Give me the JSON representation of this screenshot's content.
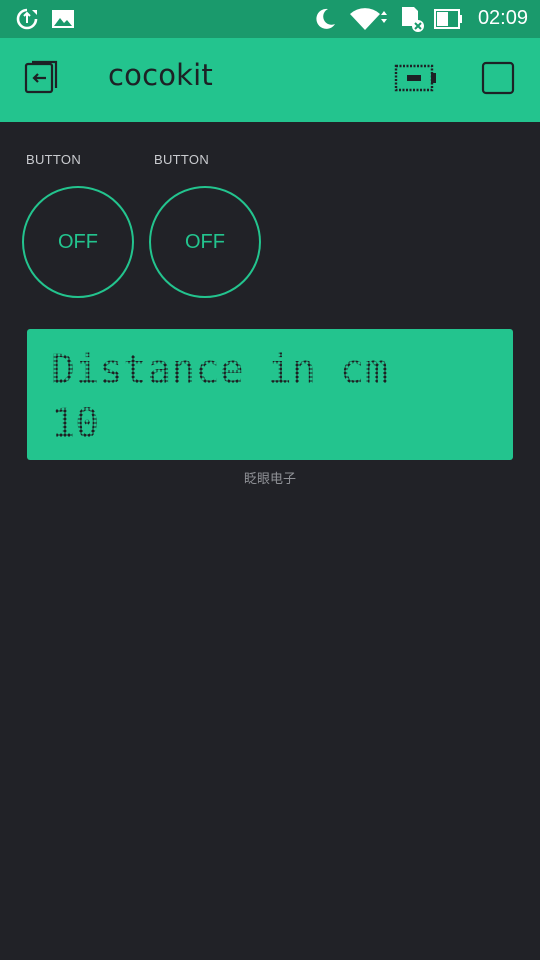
{
  "status_bar": {
    "time": "02:09",
    "icons": [
      "sync-icon",
      "image-icon",
      "moon-icon",
      "wifi-icon",
      "sd-card-icon",
      "battery-icon"
    ]
  },
  "toolbar": {
    "title": "cocokit",
    "icons": [
      "exit-icon",
      "device-icon",
      "stop-square-icon"
    ]
  },
  "buttons": [
    {
      "label": "BUTTON",
      "state": "OFF"
    },
    {
      "label": "BUTTON",
      "state": "OFF"
    }
  ],
  "lcd": {
    "line1": "Distance in cm",
    "line2": "10",
    "caption": "眨眼电子"
  },
  "colors": {
    "accent": "#23c48e",
    "status_bar": "#1a9a6c",
    "background": "#212227",
    "lcd_text": "#1e1f22"
  }
}
